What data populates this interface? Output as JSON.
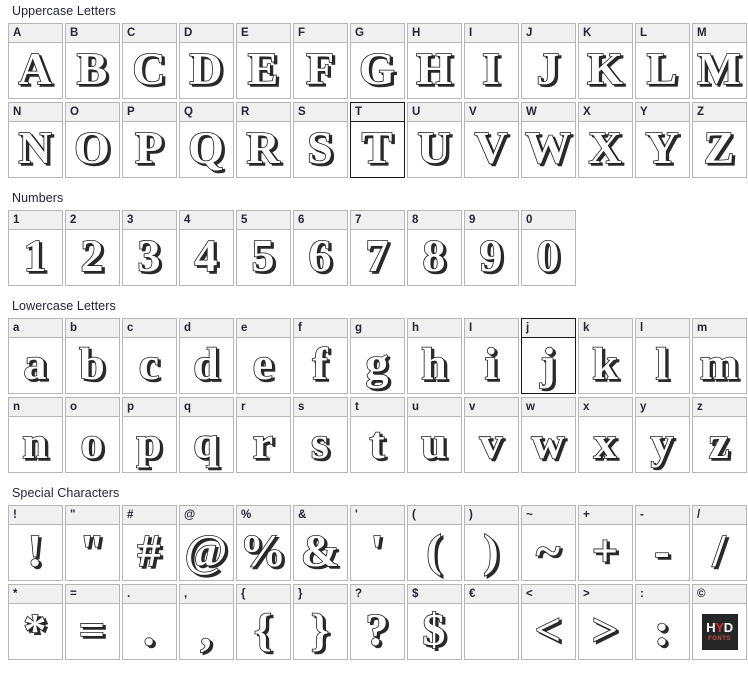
{
  "page": {
    "background": "#ffffff",
    "header_bg": "#f0f0f0",
    "border_color": "#b6b6b6",
    "selected_border_color": "#1a1a1a",
    "label_color": "#22223b"
  },
  "sections": [
    {
      "id": "uppercase",
      "title": "Uppercase Letters",
      "rows": [
        [
          {
            "label": "A",
            "glyph": "A",
            "selected": false
          },
          {
            "label": "B",
            "glyph": "B",
            "selected": false
          },
          {
            "label": "C",
            "glyph": "C",
            "selected": false
          },
          {
            "label": "D",
            "glyph": "D",
            "selected": false
          },
          {
            "label": "E",
            "glyph": "E",
            "selected": false
          },
          {
            "label": "F",
            "glyph": "F",
            "selected": false
          },
          {
            "label": "G",
            "glyph": "G",
            "selected": false
          },
          {
            "label": "H",
            "glyph": "H",
            "selected": false
          },
          {
            "label": "I",
            "glyph": "I",
            "selected": false
          },
          {
            "label": "J",
            "glyph": "J",
            "selected": false
          },
          {
            "label": "K",
            "glyph": "K",
            "selected": false
          },
          {
            "label": "L",
            "glyph": "L",
            "selected": false
          },
          {
            "label": "M",
            "glyph": "M",
            "selected": false
          }
        ],
        [
          {
            "label": "N",
            "glyph": "N",
            "selected": false
          },
          {
            "label": "O",
            "glyph": "O",
            "selected": false
          },
          {
            "label": "P",
            "glyph": "P",
            "selected": false
          },
          {
            "label": "Q",
            "glyph": "Q",
            "selected": false
          },
          {
            "label": "R",
            "glyph": "R",
            "selected": false
          },
          {
            "label": "S",
            "glyph": "S",
            "selected": false
          },
          {
            "label": "T",
            "glyph": "T",
            "selected": true
          },
          {
            "label": "U",
            "glyph": "U",
            "selected": false
          },
          {
            "label": "V",
            "glyph": "V",
            "selected": false
          },
          {
            "label": "W",
            "glyph": "W",
            "selected": false
          },
          {
            "label": "X",
            "glyph": "X",
            "selected": false
          },
          {
            "label": "Y",
            "glyph": "Y",
            "selected": false
          },
          {
            "label": "Z",
            "glyph": "Z",
            "selected": false
          }
        ]
      ]
    },
    {
      "id": "numbers",
      "title": "Numbers",
      "rows": [
        [
          {
            "label": "1",
            "glyph": "1",
            "selected": false
          },
          {
            "label": "2",
            "glyph": "2",
            "selected": false
          },
          {
            "label": "3",
            "glyph": "3",
            "selected": false
          },
          {
            "label": "4",
            "glyph": "4",
            "selected": false
          },
          {
            "label": "5",
            "glyph": "5",
            "selected": false
          },
          {
            "label": "6",
            "glyph": "6",
            "selected": false
          },
          {
            "label": "7",
            "glyph": "7",
            "selected": false
          },
          {
            "label": "8",
            "glyph": "8",
            "selected": false
          },
          {
            "label": "9",
            "glyph": "9",
            "selected": false
          },
          {
            "label": "0",
            "glyph": "0",
            "selected": false
          }
        ]
      ]
    },
    {
      "id": "lowercase",
      "title": "Lowercase Letters",
      "rows": [
        [
          {
            "label": "a",
            "glyph": "a",
            "selected": false
          },
          {
            "label": "b",
            "glyph": "b",
            "selected": false
          },
          {
            "label": "c",
            "glyph": "c",
            "selected": false
          },
          {
            "label": "d",
            "glyph": "d",
            "selected": false
          },
          {
            "label": "e",
            "glyph": "e",
            "selected": false
          },
          {
            "label": "f",
            "glyph": "f",
            "selected": false
          },
          {
            "label": "g",
            "glyph": "g",
            "selected": false
          },
          {
            "label": "h",
            "glyph": "h",
            "selected": false
          },
          {
            "label": "I",
            "glyph": "i",
            "selected": false
          },
          {
            "label": "j",
            "glyph": "j",
            "selected": true
          },
          {
            "label": "k",
            "glyph": "k",
            "selected": false
          },
          {
            "label": "l",
            "glyph": "l",
            "selected": false
          },
          {
            "label": "m",
            "glyph": "m",
            "selected": false
          }
        ],
        [
          {
            "label": "n",
            "glyph": "n",
            "selected": false
          },
          {
            "label": "o",
            "glyph": "o",
            "selected": false
          },
          {
            "label": "p",
            "glyph": "p",
            "selected": false
          },
          {
            "label": "q",
            "glyph": "q",
            "selected": false
          },
          {
            "label": "r",
            "glyph": "r",
            "selected": false
          },
          {
            "label": "s",
            "glyph": "s",
            "selected": false
          },
          {
            "label": "t",
            "glyph": "t",
            "selected": false
          },
          {
            "label": "u",
            "glyph": "u",
            "selected": false
          },
          {
            "label": "v",
            "glyph": "v",
            "selected": false
          },
          {
            "label": "w",
            "glyph": "w",
            "selected": false
          },
          {
            "label": "x",
            "glyph": "x",
            "selected": false
          },
          {
            "label": "y",
            "glyph": "y",
            "selected": false
          },
          {
            "label": "z",
            "glyph": "z",
            "selected": false
          }
        ]
      ]
    },
    {
      "id": "special",
      "title": "Special Characters",
      "rows": [
        [
          {
            "label": "!",
            "glyph": "!",
            "selected": false
          },
          {
            "label": "\"",
            "glyph": "\"",
            "selected": false
          },
          {
            "label": "#",
            "glyph": "#",
            "selected": false
          },
          {
            "label": "@",
            "glyph": "@",
            "selected": false
          },
          {
            "label": "%",
            "glyph": "%",
            "selected": false
          },
          {
            "label": "&",
            "glyph": "&",
            "selected": false
          },
          {
            "label": "'",
            "glyph": "'",
            "selected": false
          },
          {
            "label": "(",
            "glyph": "(",
            "selected": false
          },
          {
            "label": ")",
            "glyph": ")",
            "selected": false
          },
          {
            "label": "~",
            "glyph": "~",
            "selected": false
          },
          {
            "label": "+",
            "glyph": "+",
            "selected": false
          },
          {
            "label": "-",
            "glyph": "-",
            "selected": false
          },
          {
            "label": "/",
            "glyph": "/",
            "selected": false
          }
        ],
        [
          {
            "label": "*",
            "glyph": "*",
            "selected": false
          },
          {
            "label": "=",
            "glyph": "=",
            "selected": false
          },
          {
            "label": ".",
            "glyph": ".",
            "selected": false
          },
          {
            "label": ",",
            "glyph": ",",
            "selected": false
          },
          {
            "label": "{",
            "glyph": "{",
            "selected": false
          },
          {
            "label": "}",
            "glyph": "}",
            "selected": false
          },
          {
            "label": "?",
            "glyph": "?",
            "selected": false
          },
          {
            "label": "$",
            "glyph": "$",
            "selected": false
          },
          {
            "label": "€",
            "glyph": "",
            "selected": false
          },
          {
            "label": "<",
            "glyph": "<",
            "selected": false
          },
          {
            "label": ">",
            "glyph": ">",
            "selected": false
          },
          {
            "label": ":",
            "glyph": ":",
            "selected": false
          },
          {
            "label": "©",
            "glyph": "",
            "selected": false,
            "logo": true
          }
        ]
      ]
    }
  ],
  "logo": {
    "name": "hyd-fonts-logo",
    "line1_main": "H",
    "line1_accent": "Y",
    "line1_tail": "D",
    "line2": "FONTS",
    "bg": "#262626",
    "accent_color": "#d03030"
  }
}
